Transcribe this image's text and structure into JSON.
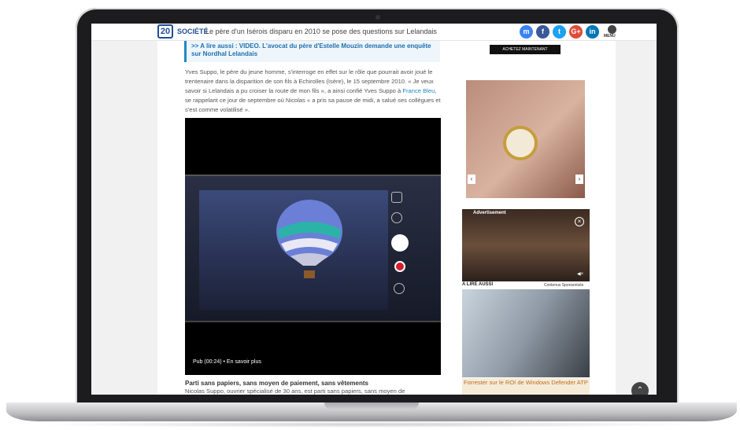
{
  "topbar": {
    "logo": "20",
    "section": "SOCIÉTÉ",
    "headline": "Le père d'un Isérois disparu en 2010 se pose des questions sur Lelandais",
    "share": [
      {
        "name": "messenger-icon",
        "glyph": "m",
        "color": "#3b82f6"
      },
      {
        "name": "facebook-icon",
        "glyph": "f",
        "color": "#3b5998"
      },
      {
        "name": "twitter-icon",
        "glyph": "t",
        "color": "#1da1f2"
      },
      {
        "name": "google-plus-icon",
        "glyph": "G+",
        "color": "#dd4b39"
      },
      {
        "name": "linkedin-icon",
        "glyph": "in",
        "color": "#0077b5"
      }
    ],
    "menu_label": "MENU"
  },
  "article": {
    "related_line1": ">> A lire aussi : VIDEO. L'avocat du père d'Estelle Mouzin demande une enquête",
    "related_line2": "sur Nordhal Lelandais",
    "para_part1": "Yves Suppo, le père du jeune homme, s'interroge en effet sur le rôle que pourrait avoir joué le trentenaire dans la disparition de son fils à Echirolles (Isère), le 15 septembre 2010. « Je veux savoir si Lelandais a pu croiser la route de mon fils », a ainsi confié Yves Suppo à ",
    "para_link": "France Bleu",
    "para_part2": ", se rappelant ce jour de septembre où Nicolas « a pris sa pause de midi, a salué ses collègues et s'est comme volatilisé ».",
    "video_overlay": "Pub (00:24) • En savoir plus",
    "subhead": "Parti sans papiers, sans moyen de paiement, sans vêtements",
    "subtext": "Nicolas Suppo, ouvrier spécialisé de 30 ans, est parti sans papiers, sans moyen de"
  },
  "ads": {
    "buy_button": "ACHETEZ MAINTENANT",
    "advertisement_label": "Advertisement",
    "lire_aussi": "A LIRE AUSSI",
    "contenus": "Contenus Sponsorisés",
    "promo_text": "Forrester sur le ROI de Windows Defender ATP"
  }
}
